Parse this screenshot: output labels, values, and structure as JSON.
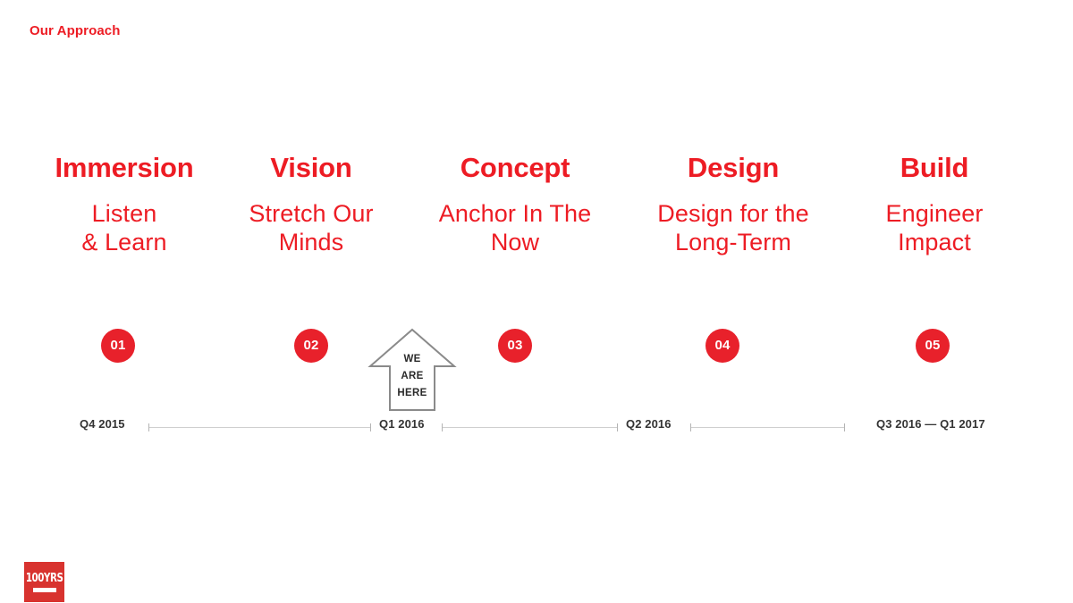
{
  "slide": {
    "title": "Our Approach",
    "brand_red": "#ed1c24",
    "badge_red": "#e8212b",
    "timeline_gray": "#cfcfcf",
    "marker_gray": "#8a8a8a"
  },
  "phases": [
    {
      "number": "01",
      "name": "Immersion",
      "tagline_lines": [
        "Listen",
        "& Learn"
      ]
    },
    {
      "number": "02",
      "name": "Vision",
      "tagline_lines": [
        "Stretch Our",
        "Minds"
      ]
    },
    {
      "number": "03",
      "name": "Concept",
      "tagline_lines": [
        "Anchor In The",
        "Now"
      ]
    },
    {
      "number": "04",
      "name": "Design",
      "tagline_lines": [
        "Design for the",
        "Long-Term"
      ]
    },
    {
      "number": "05",
      "name": "Build",
      "tagline_lines": [
        "Engineer",
        "Impact"
      ]
    }
  ],
  "here_marker": {
    "lines": [
      "WE",
      "ARE",
      "HERE"
    ],
    "icon": "up-arrow-marker"
  },
  "timeline": {
    "labels": [
      "Q4 2015",
      "Q1 2016",
      "Q2 2016",
      "Q3 2016 — Q1 2017"
    ]
  },
  "logo": {
    "word": "100YRS"
  }
}
